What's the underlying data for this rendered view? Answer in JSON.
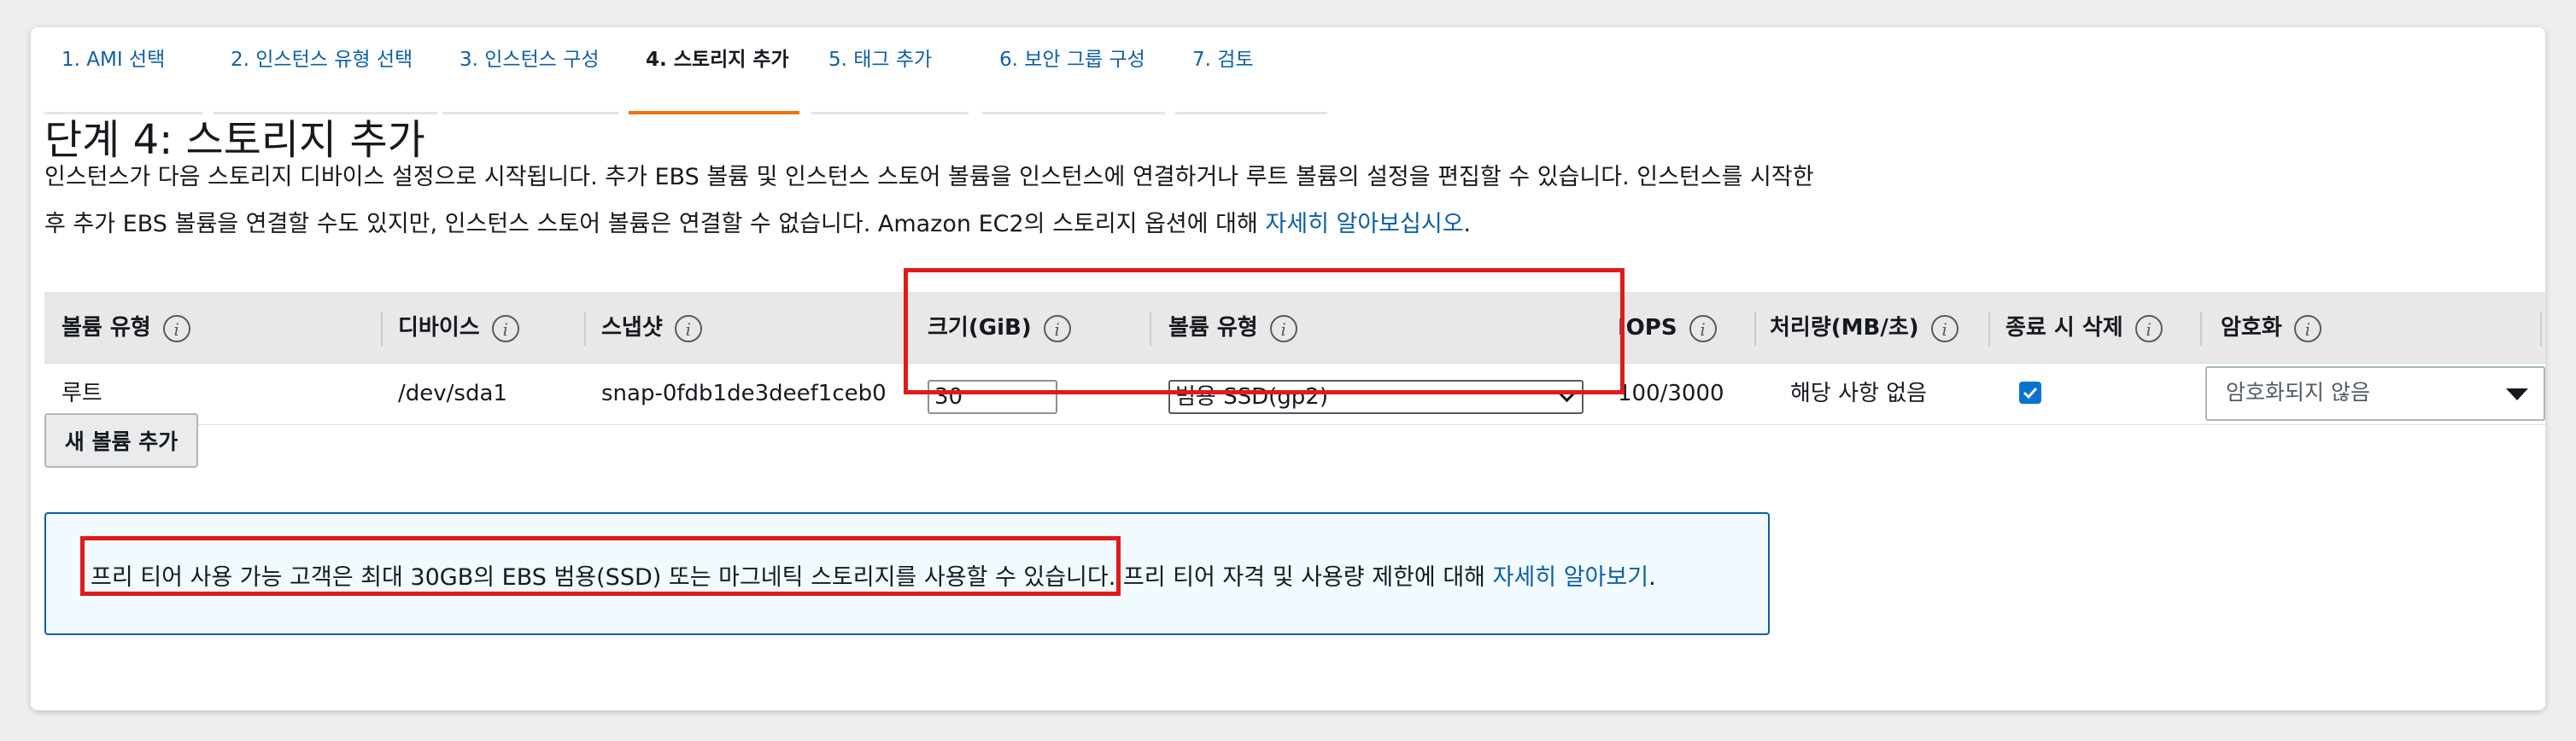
{
  "wizard": {
    "steps": [
      {
        "label": "1. AMI 선택"
      },
      {
        "label": "2. 인스턴스 유형 선택"
      },
      {
        "label": "3. 인스턴스 구성"
      },
      {
        "label": "4. 스토리지 추가"
      },
      {
        "label": "5. 태그 추가"
      },
      {
        "label": "6. 보안 그룹 구성"
      },
      {
        "label": "7. 검토"
      }
    ],
    "active_step": 4
  },
  "page": {
    "title": "단계 4: 스토리지 추가",
    "description_line1": "인스턴스가 다음 스토리지 디바이스 설정으로 시작됩니다. 추가 EBS 볼륨 및 인스턴스 스토어 볼륨을 인스턴스에 연결하거나 루트 볼륨의 설정을 편집할 수 있습니다. 인스턴스를 시작한",
    "description_line2": "후 추가 EBS 볼륨을 연결할 수도 있지만, 인스턴스 스토어 볼륨은 연결할 수 없습니다. Amazon EC2의 스토리지 옵션에 대해 ",
    "learn_more_link": "자세히 알아보십시오",
    "period": "."
  },
  "table": {
    "headers": {
      "volume_type": "볼륨 유형",
      "device": "디바이스",
      "snapshot": "스냅샷",
      "size": "크기(GiB)",
      "volume_kind": "볼륨 유형",
      "iops": "IOPS",
      "throughput": "처리량(MB/초)",
      "delete_on_termination": "종료 시 삭제",
      "encryption": "암호화"
    },
    "info_icon": "i",
    "row": {
      "volume_type": "루트",
      "device": "/dev/sda1",
      "snapshot": "snap-0fdb1de3deef1ceb0",
      "size": "30",
      "volume_kind": "범용 SSD(gp2)",
      "iops": "100/3000",
      "throughput": "해당 사항 없음",
      "delete_on_termination": true,
      "encryption": "암호화되지 않음"
    }
  },
  "add_volume_button": "새 볼륨 추가",
  "free_tier_banner": {
    "text_main": "프리 티어 사용 가능 고객은 최대 30GB의 EBS 범용(SSD) 또는 마그네틱 스토리지를 사용할 수 있습니다.",
    "text_rest": " 프리 티어 자격 및 사용량 제한에 대해 ",
    "link": "자세히 알아보기",
    "period": "."
  },
  "colors": {
    "link": "#0f5ea6",
    "active_tab": "#ec7211",
    "highlight": "#e01b1b",
    "checkbox": "#0972d3",
    "banner_bg": "#f1faff"
  }
}
